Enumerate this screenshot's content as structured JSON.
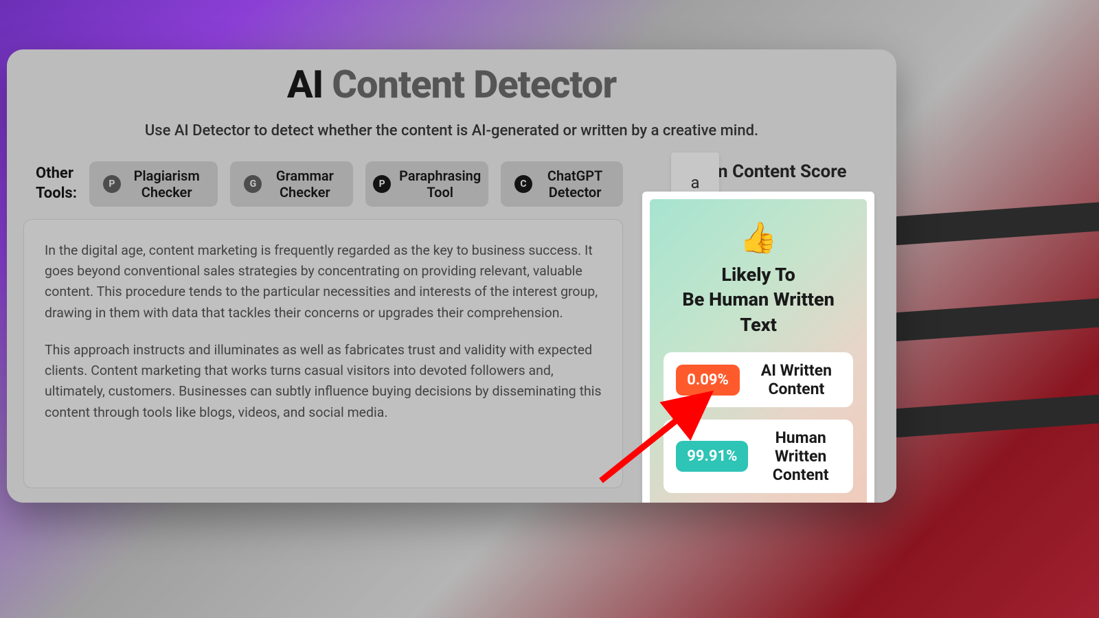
{
  "header": {
    "title_bold": "AI",
    "title_muted": "Content Detector",
    "subtitle": "Use AI Detector to detect whether the content is AI-generated or written by a creative mind."
  },
  "sidebar_label": "Other Tools:",
  "tools": [
    {
      "icon_letter": "P",
      "icon_style": "grey",
      "label": "Plagiarism Checker"
    },
    {
      "icon_letter": "G",
      "icon_style": "grey",
      "label": "Grammar Checker"
    },
    {
      "icon_letter": "P",
      "icon_style": "dark",
      "label": "Paraphrasing Tool"
    },
    {
      "icon_letter": "C",
      "icon_style": "dark",
      "label": "ChatGPT Detector"
    }
  ],
  "content": {
    "paragraph1": "In the digital age, content marketing is frequently regarded as the key to business success. It goes beyond conventional sales strategies by concentrating on providing relevant, valuable content. This procedure tends to the particular necessities and interests of the interest group, drawing in them with data that tackles their concerns or upgrades their comprehension.",
    "paragraph2": "This approach instructs and illuminates as well as fabricates trust and validity with expected clients. Content marketing that works turns casual visitors into devoted followers and, ultimately, customers. Businesses can subtly influence buying decisions by disseminating this content through tools like blogs, videos, and social media."
  },
  "score": {
    "title": "Human Content Score",
    "emoji": "👍",
    "verdict_line1": "Likely To",
    "verdict_line2": "Be Human Written Text",
    "ai_percent": "0.09%",
    "ai_label": "AI Written Content",
    "human_percent": "99.91%",
    "human_label": "Human Written Content"
  },
  "colors": {
    "ai_badge": "#ff5a2c",
    "human_badge": "#2ec4b6"
  }
}
